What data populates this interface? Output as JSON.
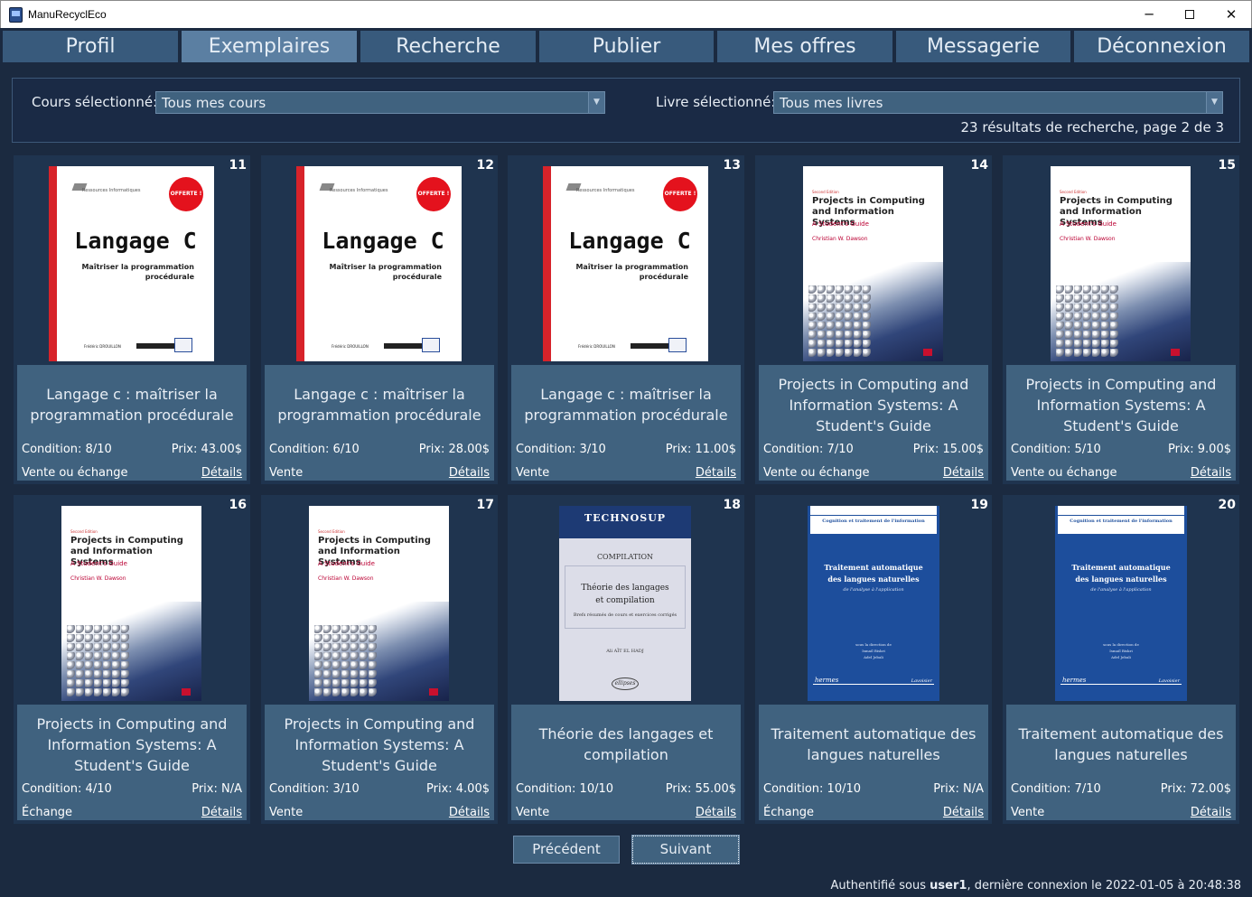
{
  "window": {
    "title": "ManuRecyclEco",
    "minimize": "─",
    "maximize": "",
    "close": "✕"
  },
  "nav": {
    "tabs": [
      "Profil",
      "Exemplaires",
      "Recherche",
      "Publier",
      "Mes offres",
      "Messagerie",
      "Déconnexion"
    ],
    "active": "Exemplaires"
  },
  "filter": {
    "course_label": "Cours sélectionné:",
    "course_value": "Tous mes cours",
    "book_label": "Livre sélectionné:",
    "book_value": "Tous mes livres",
    "results": "23 résultats de recherche, page 2 de 3"
  },
  "covers": {
    "langage": {
      "badge": "OFFERTE !",
      "brand": "Ressources Informatiques",
      "title": "Langage C",
      "subtitle_1": "Maîtriser la programmation",
      "subtitle_2": "procédurale",
      "author": "Frédéric DROUILLON"
    },
    "projects": {
      "edition": "Second Edition",
      "title_1": "Projects in Computing",
      "title_2": "and Information Systems",
      "subtitle": "A Student's Guide",
      "author": "Christian W. Dawson"
    },
    "theorie": {
      "series": "TECHNOSUP",
      "topic": "COMPILATION",
      "title_1": "Théorie des langages",
      "title_2": "et compilation",
      "note": "Brefs résumés de cours et exercices corrigés",
      "author": "Ali AÏT EL HADJ",
      "publisher": "ellipses"
    },
    "traitement": {
      "collection": "Cognition et traitement de l'information",
      "title_1": "Traitement automatique",
      "title_2": "des langues naturelles",
      "subtitle": "de l'analyse à l'application",
      "direction": "sous la direction de",
      "editor_1": "Ismaïl Biskri",
      "editor_2": "Adel Jebali",
      "publisher_1": "hermes",
      "publisher_2": "Lavoisier"
    }
  },
  "books": [
    {
      "num": "11",
      "cover": "langage",
      "title": "Langage c : maîtriser la programmation procédurale",
      "condition": "Condition: 8/10",
      "price": "Prix: 43.00$",
      "mode": "Vente ou échange",
      "details": "Détails"
    },
    {
      "num": "12",
      "cover": "langage",
      "title": "Langage c : maîtriser la programmation procédurale",
      "condition": "Condition: 6/10",
      "price": "Prix: 28.00$",
      "mode": "Vente",
      "details": "Détails"
    },
    {
      "num": "13",
      "cover": "langage",
      "title": "Langage c : maîtriser la programmation procédurale",
      "condition": "Condition: 3/10",
      "price": "Prix: 11.00$",
      "mode": "Vente",
      "details": "Détails"
    },
    {
      "num": "14",
      "cover": "projects",
      "title": "Projects in Computing and Information Systems: A Student's Guide",
      "condition": "Condition: 7/10",
      "price": "Prix: 15.00$",
      "mode": "Vente ou échange",
      "details": "Détails"
    },
    {
      "num": "15",
      "cover": "projects",
      "title": "Projects in Computing and Information Systems: A Student's Guide",
      "condition": "Condition: 5/10",
      "price": "Prix: 9.00$",
      "mode": "Vente ou échange",
      "details": "Détails"
    },
    {
      "num": "16",
      "cover": "projects",
      "title": "Projects in Computing and Information Systems: A Student's Guide",
      "condition": "Condition: 4/10",
      "price": "Prix: N/A",
      "mode": "Échange",
      "details": "Détails"
    },
    {
      "num": "17",
      "cover": "projects",
      "title": "Projects in Computing and Information Systems: A Student's Guide",
      "condition": "Condition: 3/10",
      "price": "Prix: 4.00$",
      "mode": "Vente",
      "details": "Détails"
    },
    {
      "num": "18",
      "cover": "theorie",
      "title": "Théorie des langages et compilation",
      "condition": "Condition: 10/10",
      "price": "Prix: 55.00$",
      "mode": "Vente",
      "details": "Détails"
    },
    {
      "num": "19",
      "cover": "traitement",
      "title": "Traitement automatique des langues naturelles",
      "condition": "Condition: 10/10",
      "price": "Prix: N/A",
      "mode": "Échange",
      "details": "Détails"
    },
    {
      "num": "20",
      "cover": "traitement",
      "title": "Traitement automatique des langues naturelles",
      "condition": "Condition: 7/10",
      "price": "Prix: 72.00$",
      "mode": "Vente",
      "details": "Détails"
    }
  ],
  "pagination": {
    "prev": "Précédent",
    "next": "Suivant"
  },
  "status": {
    "prefix": "Authentifié sous",
    "user": "user1",
    "suffix": ", dernière connexion le 2022-01-05 à 20:48:38"
  }
}
